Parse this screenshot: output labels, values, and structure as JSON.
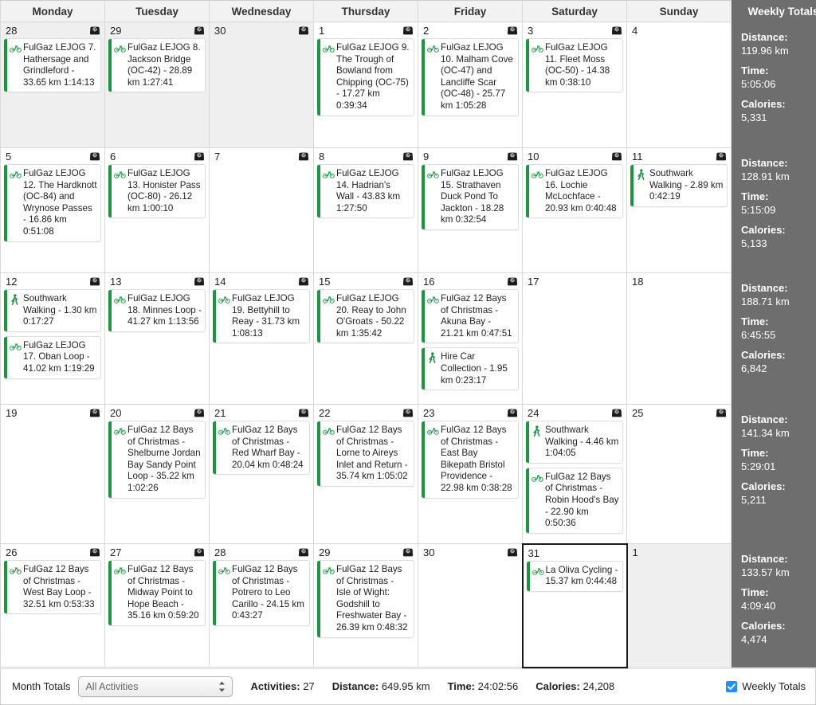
{
  "colors": {
    "accent_green": "#1a9641",
    "totals_bg": "#6e6e6e",
    "header_bg": "#f2f2f2",
    "othermonth_bg": "#efefef",
    "checkbox_blue": "#1f8fff"
  },
  "header": {
    "days": [
      "Monday",
      "Tuesday",
      "Wednesday",
      "Thursday",
      "Friday",
      "Saturday",
      "Sunday"
    ],
    "totals_label": "Weekly Totals"
  },
  "weeks": [
    {
      "days": [
        {
          "num": "28",
          "other_month": true,
          "today": false,
          "has_scale": true,
          "events": [
            {
              "type": "bike",
              "text": "FulGaz LEJOG 7. Hathersage and Grindleford - 33.65 km 1:14:13"
            }
          ]
        },
        {
          "num": "29",
          "other_month": true,
          "today": false,
          "has_scale": true,
          "events": [
            {
              "type": "bike",
              "text": "FulGaz LEJOG 8. Jackson Bridge (OC-42) - 28.89 km 1:27:41"
            }
          ]
        },
        {
          "num": "30",
          "other_month": true,
          "today": false,
          "has_scale": true,
          "events": []
        },
        {
          "num": "1",
          "other_month": false,
          "today": false,
          "has_scale": true,
          "events": [
            {
              "type": "bike",
              "text": "FulGaz LEJOG 9. The Trough of Bowland from Chipping (OC-75) - 17.27 km 0:39:34"
            }
          ]
        },
        {
          "num": "2",
          "other_month": false,
          "today": false,
          "has_scale": true,
          "events": [
            {
              "type": "bike",
              "text": "FulGaz LEJOG 10. Malham Cove (OC-47)  and Lancliffe Scar (OC-48) - 25.77 km 1:05:28"
            }
          ]
        },
        {
          "num": "3",
          "other_month": false,
          "today": false,
          "has_scale": true,
          "events": [
            {
              "type": "bike",
              "text": "FulGaz LEJOG 11. Fleet Moss (OC-50) - 14.38 km 0:38:10"
            }
          ]
        },
        {
          "num": "4",
          "other_month": false,
          "today": false,
          "has_scale": false,
          "events": []
        }
      ],
      "totals": {
        "distance_label": "Distance:",
        "distance": "119.96 km",
        "time_label": "Time:",
        "time": "5:05:06",
        "calories_label": "Calories:",
        "calories": "5,331"
      }
    },
    {
      "days": [
        {
          "num": "5",
          "other_month": false,
          "today": false,
          "has_scale": true,
          "events": [
            {
              "type": "bike",
              "text": "FulGaz LEJOG 12. The Hardknott (OC-84) and Wrynose Passes - 16.86 km 0:51:08"
            }
          ]
        },
        {
          "num": "6",
          "other_month": false,
          "today": false,
          "has_scale": true,
          "events": [
            {
              "type": "bike",
              "text": "FulGaz LEJOG 13. Honister Pass (OC-80) - 26.12 km 1:00:10"
            }
          ]
        },
        {
          "num": "7",
          "other_month": false,
          "today": false,
          "has_scale": true,
          "events": []
        },
        {
          "num": "8",
          "other_month": false,
          "today": false,
          "has_scale": true,
          "events": [
            {
              "type": "bike",
              "text": "FulGaz LEJOG 14. Hadrian's Wall - 43.83 km 1:27:50"
            }
          ]
        },
        {
          "num": "9",
          "other_month": false,
          "today": false,
          "has_scale": true,
          "events": [
            {
              "type": "bike",
              "text": "FulGaz LEJOG 15. Strathaven Duck Pond To Jackton - 18.28 km 0:32:54"
            }
          ]
        },
        {
          "num": "10",
          "other_month": false,
          "today": false,
          "has_scale": true,
          "events": [
            {
              "type": "bike",
              "text": "FulGaz LEJOG 16. Lochie McLochface - 20.93 km 0:40:48"
            }
          ]
        },
        {
          "num": "11",
          "other_month": false,
          "today": false,
          "has_scale": true,
          "events": [
            {
              "type": "walk",
              "text": "Southwark Walking - 2.89 km 0:42:19"
            }
          ]
        }
      ],
      "totals": {
        "distance_label": "Distance:",
        "distance": "128.91 km",
        "time_label": "Time:",
        "time": "5:15:09",
        "calories_label": "Calories:",
        "calories": "5,133"
      }
    },
    {
      "days": [
        {
          "num": "12",
          "other_month": false,
          "today": false,
          "has_scale": true,
          "events": [
            {
              "type": "walk",
              "text": "Southwark Walking - 1.30 km 0:17:27"
            },
            {
              "type": "bike",
              "text": "FulGaz LEJOG 17. Oban Loop - 41.02 km 1:19:29"
            }
          ]
        },
        {
          "num": "13",
          "other_month": false,
          "today": false,
          "has_scale": true,
          "events": [
            {
              "type": "bike",
              "text": "FulGaz LEJOG 18. Minnes Loop - 41.27 km 1:13:56"
            }
          ]
        },
        {
          "num": "14",
          "other_month": false,
          "today": false,
          "has_scale": true,
          "events": [
            {
              "type": "bike",
              "text": "FulGaz LEJOG 19. Bettyhill to Reay - 31.73 km 1:08:13"
            }
          ]
        },
        {
          "num": "15",
          "other_month": false,
          "today": false,
          "has_scale": true,
          "events": [
            {
              "type": "bike",
              "text": "FulGaz LEJOG 20. Reay to John O'Groats - 50.22 km 1:35:42"
            }
          ]
        },
        {
          "num": "16",
          "other_month": false,
          "today": false,
          "has_scale": true,
          "events": [
            {
              "type": "bike",
              "text": "FulGaz 12 Bays of Christmas - Akuna Bay - 21.21 km 0:47:51"
            },
            {
              "type": "walk",
              "text": "Hire Car Collection - 1.95 km 0:23:17"
            }
          ]
        },
        {
          "num": "17",
          "other_month": false,
          "today": false,
          "has_scale": false,
          "events": []
        },
        {
          "num": "18",
          "other_month": false,
          "today": false,
          "has_scale": false,
          "events": []
        }
      ],
      "totals": {
        "distance_label": "Distance:",
        "distance": "188.71 km",
        "time_label": "Time:",
        "time": "6:45:55",
        "calories_label": "Calories:",
        "calories": "6,842"
      }
    },
    {
      "days": [
        {
          "num": "19",
          "other_month": false,
          "today": false,
          "has_scale": true,
          "events": []
        },
        {
          "num": "20",
          "other_month": false,
          "today": false,
          "has_scale": true,
          "events": [
            {
              "type": "bike",
              "text": "FulGaz 12 Bays of Christmas - Shelburne Jordan Bay Sandy Point Loop - 35.22 km 1:02:26"
            }
          ]
        },
        {
          "num": "21",
          "other_month": false,
          "today": false,
          "has_scale": true,
          "events": [
            {
              "type": "bike",
              "text": "FulGaz 12 Bays of Christmas - Red Wharf Bay - 20.04 km 0:48:24"
            }
          ]
        },
        {
          "num": "22",
          "other_month": false,
          "today": false,
          "has_scale": true,
          "events": [
            {
              "type": "bike",
              "text": "FulGaz 12 Bays of Christmas - Lorne to Aireys Inlet and Return - 35.74 km 1:05:02"
            }
          ]
        },
        {
          "num": "23",
          "other_month": false,
          "today": false,
          "has_scale": true,
          "events": [
            {
              "type": "bike",
              "text": "FulGaz 12 Bays of Christmas - East Bay Bikepath Bristol Providence - 22.98 km 0:38:28"
            }
          ]
        },
        {
          "num": "24",
          "other_month": false,
          "today": false,
          "has_scale": true,
          "events": [
            {
              "type": "walk",
              "text": "Southwark Walking - 4.46 km 1:04:05"
            },
            {
              "type": "bike",
              "text": "FulGaz 12 Bays of Christmas - Robin Hood's Bay - 22.90 km 0:50:36"
            }
          ]
        },
        {
          "num": "25",
          "other_month": false,
          "today": false,
          "has_scale": true,
          "events": []
        }
      ],
      "totals": {
        "distance_label": "Distance:",
        "distance": "141.34 km",
        "time_label": "Time:",
        "time": "5:29:01",
        "calories_label": "Calories:",
        "calories": "5,211"
      }
    },
    {
      "days": [
        {
          "num": "26",
          "other_month": false,
          "today": false,
          "has_scale": true,
          "events": [
            {
              "type": "bike",
              "text": "FulGaz 12 Bays of Christmas - West Bay Loop - 32.51 km 0:53:33"
            }
          ]
        },
        {
          "num": "27",
          "other_month": false,
          "today": false,
          "has_scale": true,
          "events": [
            {
              "type": "bike",
              "text": "FulGaz 12 Bays of Christmas - Midway Point to Hope Beach - 35.16 km 0:59:20"
            }
          ]
        },
        {
          "num": "28",
          "other_month": false,
          "today": false,
          "has_scale": true,
          "events": [
            {
              "type": "bike",
              "text": "FulGaz 12 Bays of Christmas - Potrero to Leo Carillo - 24.15 km 0:43:27"
            }
          ]
        },
        {
          "num": "29",
          "other_month": false,
          "today": false,
          "has_scale": true,
          "events": [
            {
              "type": "bike",
              "text": "FulGaz 12 Bays of Christmas - Isle of Wight: Godshill to Freshwater Bay - 26.39 km 0:48:32"
            }
          ]
        },
        {
          "num": "30",
          "other_month": false,
          "today": false,
          "has_scale": true,
          "events": []
        },
        {
          "num": "31",
          "other_month": false,
          "today": true,
          "has_scale": false,
          "events": [
            {
              "type": "bike",
              "text": "La Oliva Cycling - 15.37 km 0:44:48"
            }
          ]
        },
        {
          "num": "1",
          "other_month": true,
          "today": false,
          "has_scale": false,
          "events": []
        }
      ],
      "totals": {
        "distance_label": "Distance:",
        "distance": "133.57 km",
        "time_label": "Time:",
        "time": "4:09:40",
        "calories_label": "Calories:",
        "calories": "4,474"
      }
    }
  ],
  "footer": {
    "month_totals_label": "Month Totals",
    "activity_filter": {
      "value": "All Activities",
      "options": [
        "All Activities"
      ]
    },
    "stats": [
      {
        "label": "Activities:",
        "value": "27"
      },
      {
        "label": "Distance:",
        "value": "649.95 km"
      },
      {
        "label": "Time:",
        "value": "24:02:56"
      },
      {
        "label": "Calories:",
        "value": "24,208"
      }
    ],
    "weekly_totals_checkbox": {
      "label": "Weekly Totals",
      "checked": true
    }
  }
}
